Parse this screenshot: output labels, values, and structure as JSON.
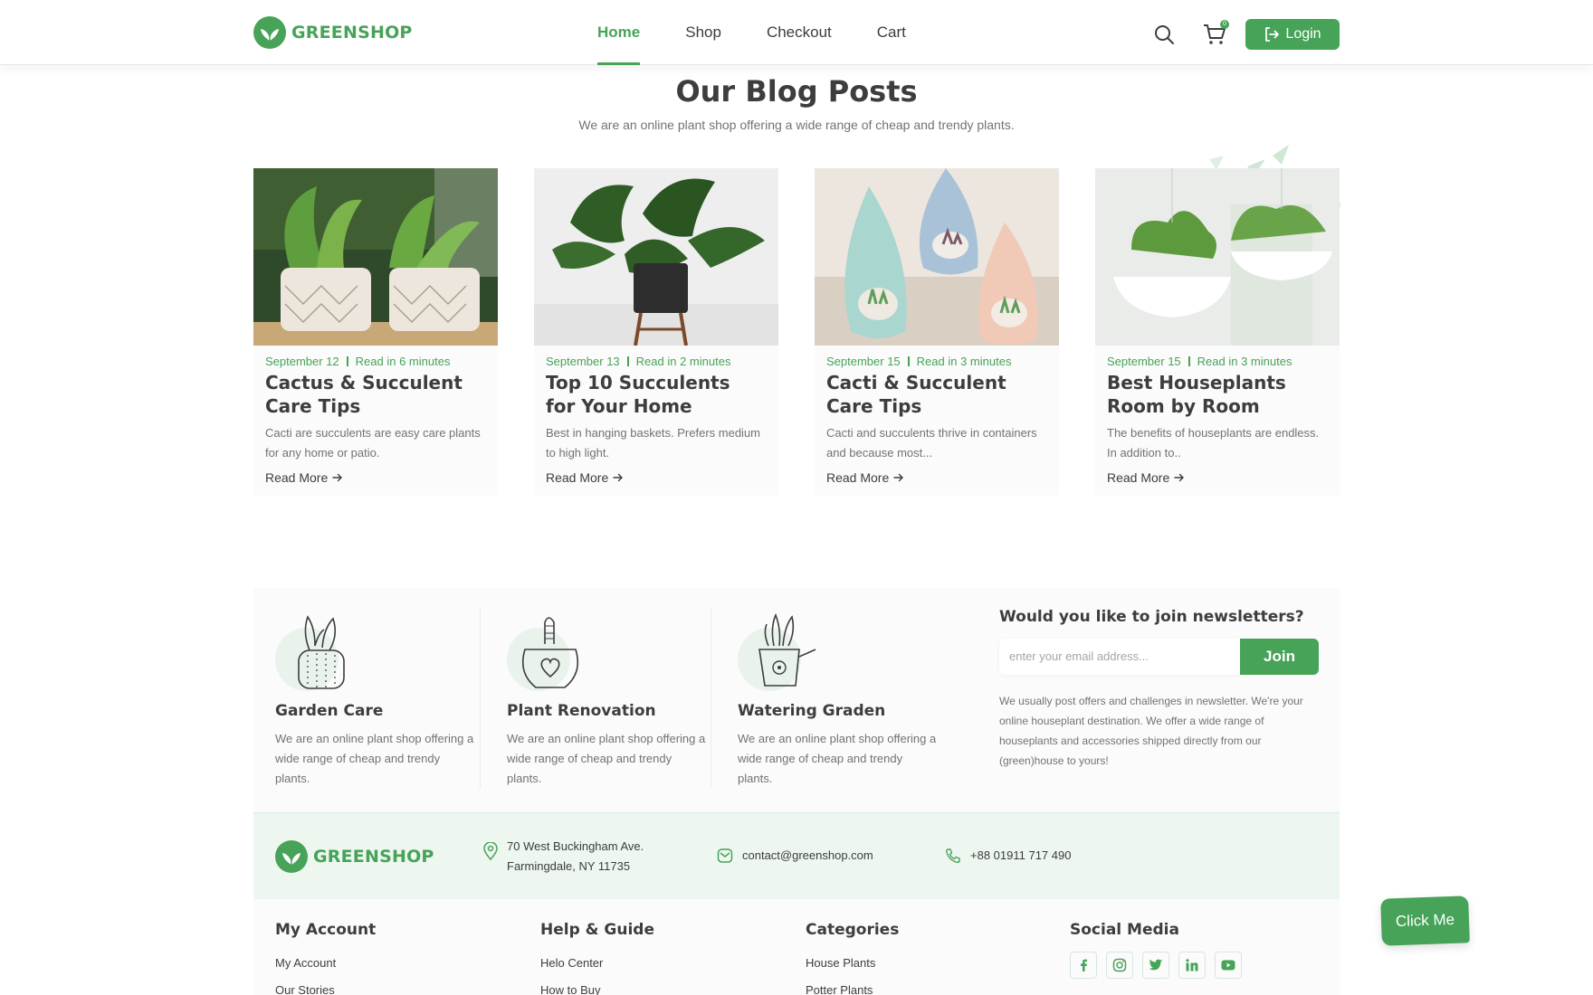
{
  "brand": {
    "name": "GREENSHOP",
    "color": "#46a358"
  },
  "nav": {
    "items": [
      {
        "label": "Home",
        "active": true
      },
      {
        "label": "Shop",
        "active": false
      },
      {
        "label": "Checkout",
        "active": false
      },
      {
        "label": "Cart",
        "active": false
      }
    ],
    "cart_count": "0",
    "login_label": "Login",
    "icons": [
      "search-icon",
      "cart-icon",
      "logout-icon"
    ]
  },
  "blog": {
    "title": "Our Blog Posts",
    "subtitle": "We are an online plant shop offering a wide range of cheap and trendy plants.",
    "posts": [
      {
        "date": "September 12",
        "read": "Read in 6 minutes",
        "title": "Cactus & Succulent Care Tips",
        "desc": "Cacti are succulents are easy care plants for any home or patio.",
        "more": "Read More"
      },
      {
        "date": "September 13",
        "read": "Read in 2 minutes",
        "title": "Top 10 Succulents for Your Home",
        "desc": "Best in hanging baskets. Prefers medium to high light.",
        "more": "Read More"
      },
      {
        "date": "September 15",
        "read": "Read in 3 minutes",
        "title": "Cacti & Succulent Care Tips",
        "desc": "Cacti and succulents thrive in containers and because most...",
        "more": "Read More"
      },
      {
        "date": "September 15",
        "read": "Read in 3 minutes",
        "title": "Best Houseplants Room by Room",
        "desc": "The benefits of houseplants are endless. In addition to..",
        "more": "Read More"
      }
    ]
  },
  "features": [
    {
      "title": "Garden Care",
      "desc": "We are an online plant shop offering a wide range of cheap and trendy plants."
    },
    {
      "title": "Plant Renovation",
      "desc": "We are an online plant shop offering a wide range of cheap and trendy plants."
    },
    {
      "title": "Watering Graden",
      "desc": "We are an online plant shop offering a wide range of cheap and trendy plants."
    }
  ],
  "newsletter": {
    "title": "Would you like to join newsletters?",
    "placeholder": "enter your email address...",
    "button": "Join",
    "text": "We usually post offers and challenges in newsletter. We're your online houseplant destination. We offer a wide range of houseplants and accessories shipped directly from our (green)house to yours!"
  },
  "contact": {
    "address_line1": "70 West Buckingham Ave.",
    "address_line2": "Farmingdale, NY 11735",
    "email": "contact@greenshop.com",
    "phone": "+88 01911 717 490"
  },
  "footer": {
    "columns": [
      {
        "title": "My Account",
        "links": [
          "My Account",
          "Our Stories"
        ]
      },
      {
        "title": "Help & Guide",
        "links": [
          "Helo Center",
          "How to Buy"
        ]
      },
      {
        "title": "Categories",
        "links": [
          "House Plants",
          "Potter Plants"
        ]
      }
    ],
    "social_title": "Social Media",
    "social_icons": [
      "facebook-icon",
      "instagram-icon",
      "twitter-icon",
      "linkedin-icon",
      "youtube-icon"
    ]
  },
  "floating_button": "Click Me"
}
